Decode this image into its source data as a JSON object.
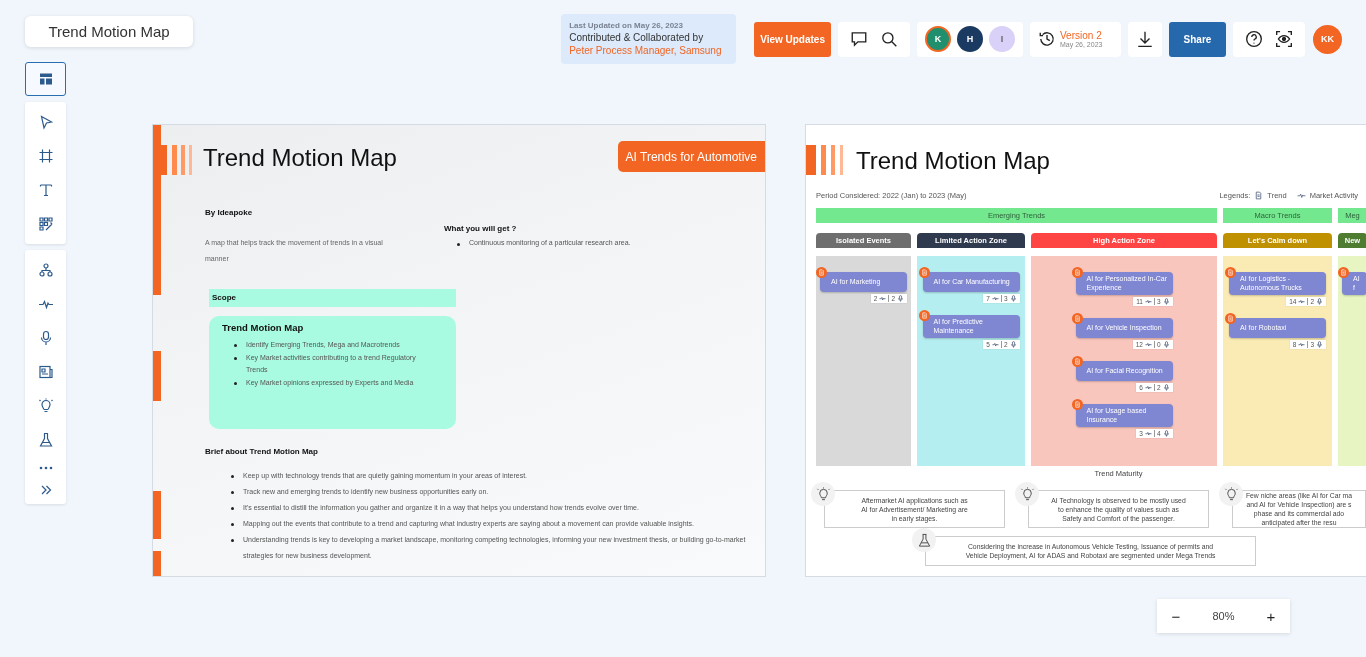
{
  "header": {
    "title": "Trend Motion Map",
    "update_info": {
      "last_updated": "Last Updated on May 26, 2023",
      "contributed_label": "Contributed & Collaborated by",
      "contributors": "Peter Process Manager, Samsung"
    },
    "view_updates_button": "View Updates",
    "collaborators": [
      {
        "initial": "K",
        "color": "#1f8f6e",
        "selected": true
      },
      {
        "initial": "H",
        "color": "#1b3a62",
        "selected": false
      },
      {
        "initial": "I",
        "color": "#d9d1f8",
        "selected": false
      }
    ],
    "version": {
      "label": "Version 2",
      "date": "May 26, 2023"
    },
    "share_button": "Share",
    "user_initials": "KK"
  },
  "sidebar": {
    "groups": [
      [
        {
          "selected": true
        }
      ],
      [
        {
          "selected": false
        },
        {
          "selected": false
        },
        {
          "selected": false
        },
        {
          "selected": false
        }
      ],
      [
        {
          "selected": false
        },
        {
          "selected": false
        },
        {
          "selected": false
        },
        {
          "selected": false
        },
        {
          "selected": false
        },
        {
          "selected": false
        },
        {
          "selected": false
        },
        {
          "selected": false
        }
      ]
    ]
  },
  "overview_slide": {
    "title": "Trend Motion Map",
    "tag": "AI Trends for Automotive",
    "author": "By Ideapoke",
    "description": "A map that helps track the movement of trends in a visual manner",
    "benefits": {
      "heading": "What you will get ?",
      "items": [
        "Continuous monitoring of a particular research area."
      ]
    },
    "scope": {
      "label": "Scope",
      "title": "Trend Motion Map",
      "items": [
        "Identify Emerging Trends, Mega and Macrotrends",
        "Key Market activities contributing to a trend Regulatory Trends",
        "Key Market opinions expressed by Experts and Media"
      ]
    },
    "brief": {
      "heading": "Brief about Trend Motion Map",
      "items": [
        "Keep up with technology trends that are quietly gaining momentum in your areas of interest.",
        "Track new and emerging trends to identify new business opportunities early on.",
        "It's essential to distill the information you gather and organize it in a way that helps you understand how trends evolve over time.",
        "Mapping out the events that contribute to a trend and capturing what industry experts are saying about a movement can provide valuable insights.",
        "Understanding trends is key to developing a market landscape, monitoring competing technologies, informing your new investment thesis, or building go-to-market strategies for new business development."
      ]
    }
  },
  "map_slide": {
    "title": "Trend Motion Map",
    "period": "Period Considered: 2022 (Jan) to 2023 (May)",
    "legend": {
      "label": "Legends:",
      "items": [
        {
          "kind": "trend",
          "label": "Trend"
        },
        {
          "kind": "activity",
          "label": "Market Activity"
        }
      ]
    },
    "bands": [
      {
        "label": "Emerging Trends",
        "columns": [
          {
            "label": "Isolated Events",
            "color": "#6e6e6e",
            "area": {
              "color": "#d9d9d9",
              "cards": [
                {
                  "title": "AI for Marketing",
                  "activity_count": "2",
                  "mic_count": "2"
                }
              ]
            }
          },
          {
            "label": "Limited Action Zone",
            "color": "#303a4e",
            "area": {
              "color": "#b5eef0",
              "cards": [
                {
                  "title": "AI for Car Manufacturing",
                  "activity_count": "7",
                  "mic_count": "3"
                },
                {
                  "title": "AI for Predictive Maintenance",
                  "activity_count": "5",
                  "mic_count": "2"
                }
              ]
            }
          },
          {
            "label": "High Action Zone",
            "color": "#ff4444",
            "area": {
              "color": "#f9c6bd",
              "cards": [
                {
                  "title": "AI for Personalized In-Car Experience",
                  "activity_count": "11",
                  "mic_count": "3"
                },
                {
                  "title": "AI for Vehicle Inspection",
                  "activity_count": "12",
                  "mic_count": "0"
                },
                {
                  "title": "AI for Facial Recognition",
                  "activity_count": "6",
                  "mic_count": "2"
                },
                {
                  "title": "AI for Usage based Insurance",
                  "activity_count": "3",
                  "mic_count": "4"
                }
              ]
            }
          }
        ]
      },
      {
        "label": "Macro Trends",
        "columns": [
          {
            "label": "Let's Calm down",
            "color": "#bf9000",
            "area": {
              "color": "#faebb5",
              "cards": [
                {
                  "title": "AI for Logistics - Autonomous Trucks",
                  "activity_count": "14",
                  "mic_count": "2"
                },
                {
                  "title": "AI for Robotaxi",
                  "activity_count": "8",
                  "mic_count": "3"
                }
              ]
            }
          }
        ]
      },
      {
        "label": "Meg",
        "columns": [
          {
            "label": "New",
            "color": "#4e7d32",
            "area": {
              "color": "#e6f5c2",
              "cards": [
                {
                  "title": "AI f"
                }
              ]
            }
          }
        ]
      }
    ],
    "axis_label": "Trend Maturity",
    "insights": [
      {
        "kind": "idea",
        "lines": [
          "Aftermarket AI applications such as",
          "AI for Advertisement/ Marketing are",
          "in early stages."
        ]
      },
      {
        "kind": "idea",
        "lines": [
          "AI Technology is observed to be mostly used",
          "to enhance the quality of values such as",
          "Safety and Comfort of the passenger."
        ]
      },
      {
        "kind": "idea",
        "lines": [
          "Few niche areas (like AI for Car ma",
          "and AI for Vehicle Inspection) are s",
          "phase and its commercial ado",
          "anticipated after the resu"
        ]
      },
      {
        "kind": "test",
        "lines": [
          "Considering the increase in Autonomous Vehicle Testing, Issuance of permits and",
          "Vehicle Deployment, AI for ADAS and Robotaxi are segmented under Mega Trends"
        ]
      }
    ]
  },
  "zoom": {
    "minus": "−",
    "value": "80%",
    "plus": "+"
  }
}
